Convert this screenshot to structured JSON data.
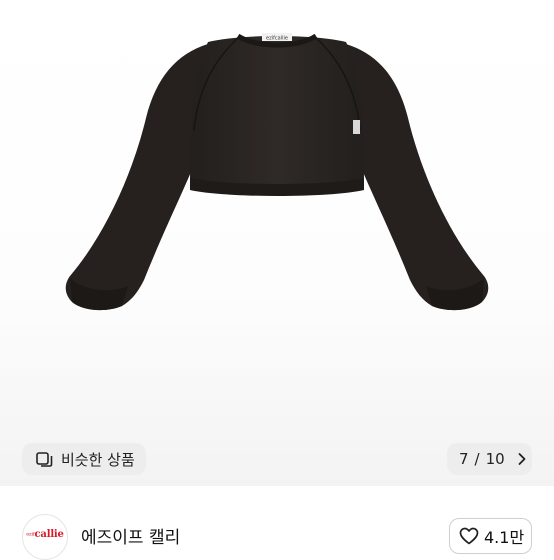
{
  "product": {
    "image_alt": "black cropped sweatshirt bolero",
    "tag_text": "ezifcallie"
  },
  "similar_button": {
    "label": "비슷한 상품",
    "icon": "similar-items-icon"
  },
  "pager": {
    "current": "7",
    "separator": "/",
    "total": "10",
    "icon": "chevron-right-icon"
  },
  "seller": {
    "avatar_text": "callie",
    "avatar_prefix": "ezif",
    "name": "에즈이프 캘리"
  },
  "like": {
    "count": "4.1만",
    "icon": "heart-outline-icon"
  },
  "colors": {
    "brand_red": "#d6192a",
    "pill_bg": "#ededed",
    "garment": "#2b2623"
  }
}
